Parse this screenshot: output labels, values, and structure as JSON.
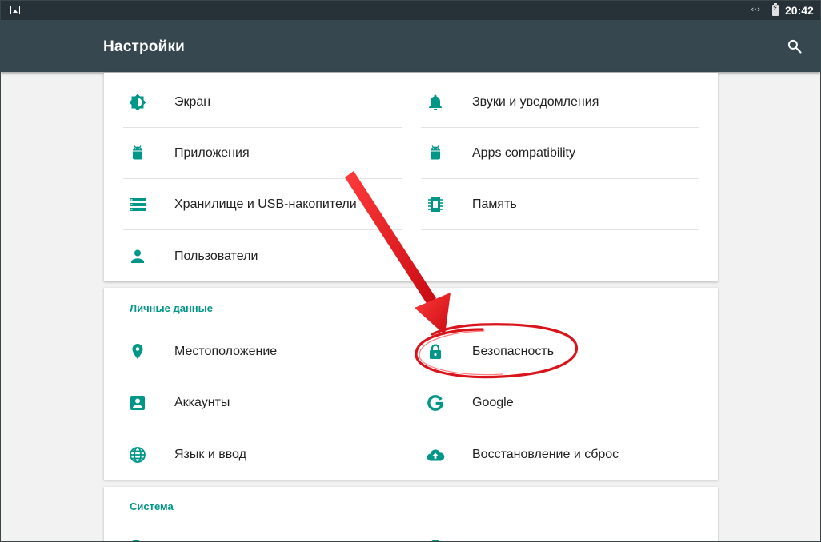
{
  "status_bar": {
    "time": "20:42",
    "sync_glyph": "‹·›"
  },
  "toolbar": {
    "title": "Настройки",
    "search_icon": "search-icon"
  },
  "device": {
    "items": [
      {
        "label": "Экран",
        "icon": "display-brightness-icon"
      },
      {
        "label": "Звуки и уведомления",
        "icon": "bell-icon"
      },
      {
        "label": "Приложения",
        "icon": "android-icon"
      },
      {
        "label": "Apps compatibility",
        "icon": "android-icon"
      },
      {
        "label": "Хранилище и USB-накопители",
        "icon": "storage-icon"
      },
      {
        "label": "Память",
        "icon": "memory-icon"
      },
      {
        "label": "Пользователи",
        "icon": "person-icon"
      }
    ]
  },
  "personal": {
    "header": "Личные данные",
    "items": [
      {
        "label": "Местоположение",
        "icon": "location-pin-icon"
      },
      {
        "label": "Безопасность",
        "icon": "lock-icon"
      },
      {
        "label": "Аккаунты",
        "icon": "account-box-icon"
      },
      {
        "label": "Google",
        "icon": "google-icon"
      },
      {
        "label": "Язык и ввод",
        "icon": "globe-icon"
      },
      {
        "label": "Восстановление и сброс",
        "icon": "cloud-upload-icon"
      }
    ]
  },
  "system": {
    "header": "Система"
  },
  "colors": {
    "accent": "#009688",
    "toolbar": "#37474f",
    "statusbar": "#263238",
    "annotation": "#e3141b"
  }
}
